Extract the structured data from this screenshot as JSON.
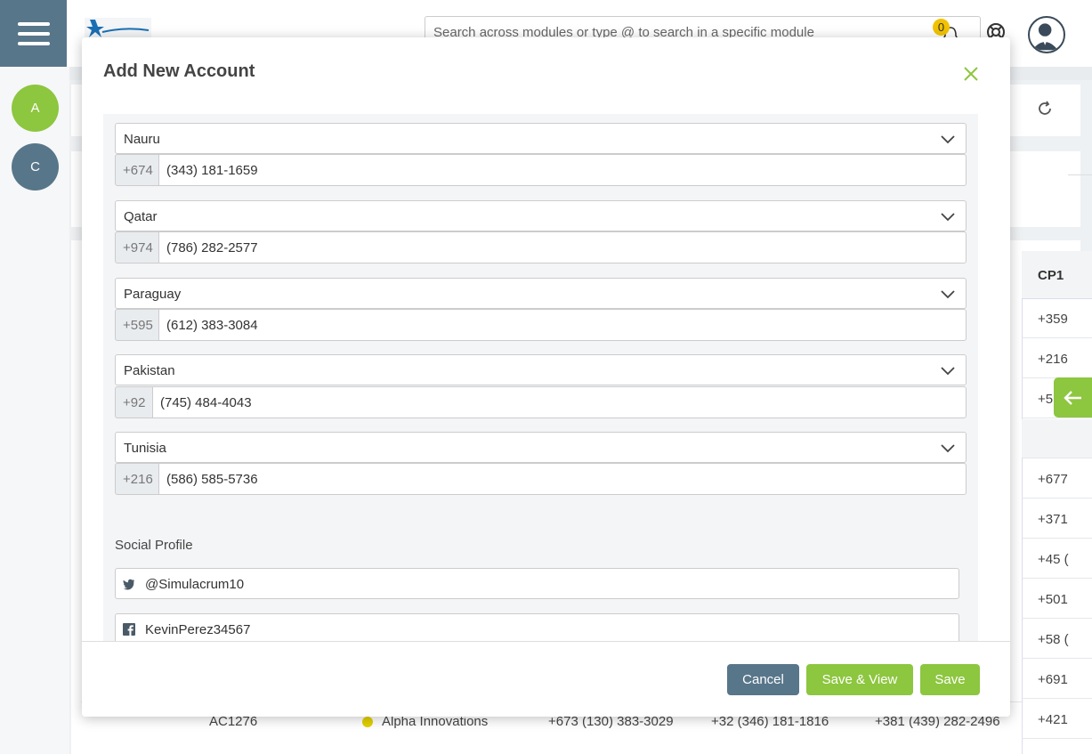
{
  "header": {
    "search_placeholder": "Search across modules or type @ to search in a specific module",
    "notification_count": "0"
  },
  "rail": {
    "items": [
      {
        "label": "A"
      },
      {
        "label": "C"
      }
    ]
  },
  "background_table": {
    "column_header": "CP1",
    "cp1_values": [
      "+359",
      "+216",
      "+5",
      "",
      "+677",
      "+371",
      "+45 (",
      "+501",
      "+58 (",
      "+691",
      "+421"
    ],
    "bottom_row": {
      "id": "AC1276",
      "account": "Alpha Innovations",
      "phone1": "+673 (130) 383-3029",
      "phone2": "+32 (346) 181-1816",
      "phone3": "+381 (439) 282-2496"
    }
  },
  "modal": {
    "title": "Add New Account",
    "phones": [
      {
        "country": "Nauru",
        "code": "+674",
        "number": "(343) 181-1659"
      },
      {
        "country": "Qatar",
        "code": "+974",
        "number": "(786) 282-2577"
      },
      {
        "country": "Paraguay",
        "code": "+595",
        "number": "(612) 383-3084"
      },
      {
        "country": "Pakistan",
        "code": "+92",
        "number": "(745) 484-4043"
      },
      {
        "country": "Tunisia",
        "code": "+216",
        "number": "(586) 585-5736"
      }
    ],
    "social": {
      "label": "Social Profile",
      "twitter": "@Simulacrum10",
      "facebook": "KevinPerez34567"
    },
    "footer": {
      "cancel_label": "Cancel",
      "save_view_label": "Save & View",
      "save_label": "Save"
    }
  },
  "colors": {
    "accent_green": "#8dc63f",
    "slate": "#58768a"
  }
}
